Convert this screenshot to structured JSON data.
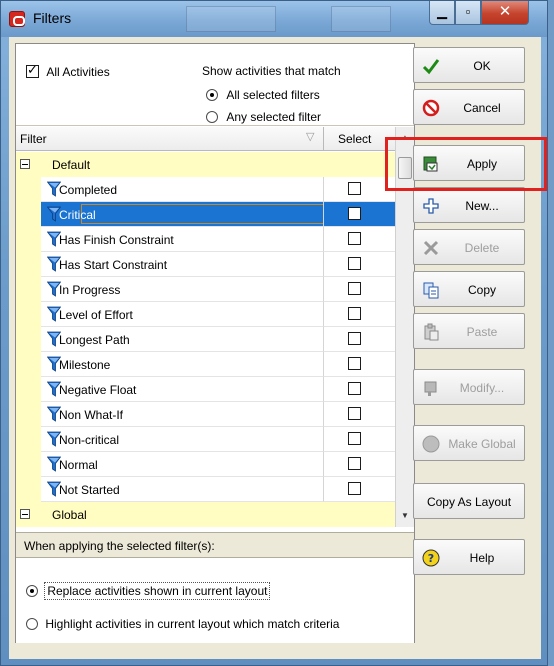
{
  "window": {
    "title": "Filters"
  },
  "top": {
    "all_activities": "All Activities",
    "all_activities_checked": true,
    "match_title": "Show activities that match",
    "match_options": [
      "All selected filters",
      "Any selected filter"
    ],
    "match_selected": 0
  },
  "grid": {
    "col_filter": "Filter",
    "col_select": "Select",
    "groups": [
      {
        "name": "Default",
        "filters": [
          "Completed",
          "Critical",
          "Has Finish Constraint",
          "Has Start Constraint",
          "In Progress",
          "Level of Effort",
          "Longest Path",
          "Milestone",
          "Negative Float",
          "Non What-If",
          "Non-critical",
          "Normal",
          "Not Started"
        ]
      },
      {
        "name": "Global",
        "filters": []
      }
    ],
    "selected_filter": "Critical"
  },
  "apply": {
    "label": "When applying the selected filter(s):",
    "options": [
      "Replace activities shown in current layout",
      "Highlight activities in current layout which match criteria"
    ],
    "selected": 0
  },
  "buttons": {
    "ok": "OK",
    "cancel": "Cancel",
    "apply": "Apply",
    "new": "New...",
    "delete": "Delete",
    "copy": "Copy",
    "paste": "Paste",
    "modify": "Modify...",
    "make_global": "Make Global",
    "copy_as_layout": "Copy As Layout",
    "help": "Help"
  },
  "colors": {
    "selection": "#1b74d1",
    "group_bg": "#fffdc2",
    "highlight": "#e0211d",
    "funnel": "#1f6fcf"
  },
  "icons": {
    "ok": "check-icon",
    "cancel": "no-entry-icon",
    "apply": "apply-icon",
    "new": "plus-icon",
    "delete": "x-icon",
    "copy": "copy-icon",
    "paste": "paste-icon",
    "modify": "modify-icon",
    "make_global": "globe-icon",
    "help": "help-icon",
    "filter": "funnel-icon"
  }
}
